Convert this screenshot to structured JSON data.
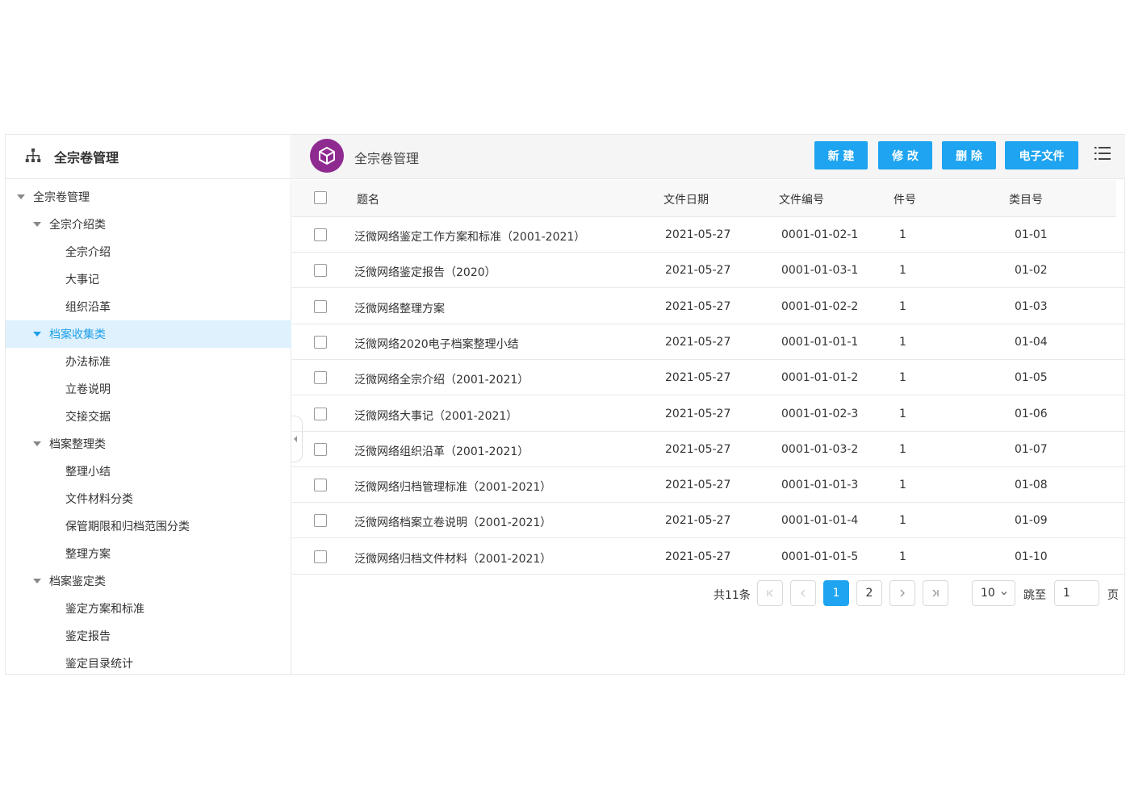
{
  "sidebar": {
    "title": "全宗卷管理",
    "tree": [
      {
        "label": "全宗卷管理",
        "level": 0,
        "expanded": true,
        "selected": false
      },
      {
        "label": "全宗介绍类",
        "level": 1,
        "expanded": true,
        "selected": false
      },
      {
        "label": "全宗介绍",
        "level": 2,
        "selected": false
      },
      {
        "label": "大事记",
        "level": 2,
        "selected": false
      },
      {
        "label": "组织沿革",
        "level": 2,
        "selected": false
      },
      {
        "label": "档案收集类",
        "level": 1,
        "expanded": true,
        "selected": true
      },
      {
        "label": "办法标准",
        "level": 2,
        "selected": false
      },
      {
        "label": "立卷说明",
        "level": 2,
        "selected": false
      },
      {
        "label": "交接交据",
        "level": 2,
        "selected": false
      },
      {
        "label": "档案整理类",
        "level": 1,
        "expanded": true,
        "selected": false
      },
      {
        "label": "整理小结",
        "level": 2,
        "selected": false
      },
      {
        "label": "文件材料分类",
        "level": 2,
        "selected": false
      },
      {
        "label": "保管期限和归档范围分类",
        "level": 2,
        "selected": false
      },
      {
        "label": "整理方案",
        "level": 2,
        "selected": false
      },
      {
        "label": "档案鉴定类",
        "level": 1,
        "expanded": true,
        "selected": false
      },
      {
        "label": "鉴定方案和标准",
        "level": 2,
        "selected": false
      },
      {
        "label": "鉴定报告",
        "level": 2,
        "selected": false
      },
      {
        "label": "鉴定目录统计",
        "level": 2,
        "selected": false
      }
    ]
  },
  "header": {
    "title": "全宗卷管理",
    "buttons": {
      "new": "新 建",
      "edit": "修 改",
      "delete": "删 除",
      "efile": "电子文件"
    }
  },
  "table": {
    "columns": {
      "title": "题名",
      "date": "文件日期",
      "code": "文件编号",
      "piece": "件号",
      "category": "类目号"
    },
    "rows": [
      {
        "title": "泛微网络鉴定工作方案和标准（2001-2021）",
        "date": "2021-05-27",
        "code": "0001-01-02-1",
        "piece": "1",
        "category": "01-01"
      },
      {
        "title": "泛微网络鉴定报告（2020）",
        "date": "2021-05-27",
        "code": "0001-01-03-1",
        "piece": "1",
        "category": "01-02"
      },
      {
        "title": "泛微网络整理方案",
        "date": "2021-05-27",
        "code": "0001-01-02-2",
        "piece": "1",
        "category": "01-03"
      },
      {
        "title": "泛微网络2020电子档案整理小结",
        "date": "2021-05-27",
        "code": "0001-01-01-1",
        "piece": "1",
        "category": "01-04"
      },
      {
        "title": "泛微网络全宗介绍（2001-2021）",
        "date": "2021-05-27",
        "code": "0001-01-01-2",
        "piece": "1",
        "category": "01-05"
      },
      {
        "title": "泛微网络大事记（2001-2021）",
        "date": "2021-05-27",
        "code": "0001-01-02-3",
        "piece": "1",
        "category": "01-06"
      },
      {
        "title": "泛微网络组织沿革（2001-2021）",
        "date": "2021-05-27",
        "code": "0001-01-03-2",
        "piece": "1",
        "category": "01-07"
      },
      {
        "title": "泛微网络归档管理标准（2001-2021）",
        "date": "2021-05-27",
        "code": "0001-01-01-3",
        "piece": "1",
        "category": "01-08"
      },
      {
        "title": "泛微网络档案立卷说明（2001-2021）",
        "date": "2021-05-27",
        "code": "0001-01-01-4",
        "piece": "1",
        "category": "01-09"
      },
      {
        "title": "泛微网络归档文件材料（2001-2021）",
        "date": "2021-05-27",
        "code": "0001-01-01-5",
        "piece": "1",
        "category": "01-10"
      }
    ]
  },
  "pagination": {
    "total": "共11条",
    "pages": [
      "1",
      "2"
    ],
    "current": "1",
    "page_size": "10",
    "jump_label": "跳至",
    "jump_value": "1",
    "page_suffix": "页"
  },
  "colors": {
    "accent": "#1ea4f0",
    "selected_bg": "#dff1fd",
    "logo": "#8f2a91"
  }
}
